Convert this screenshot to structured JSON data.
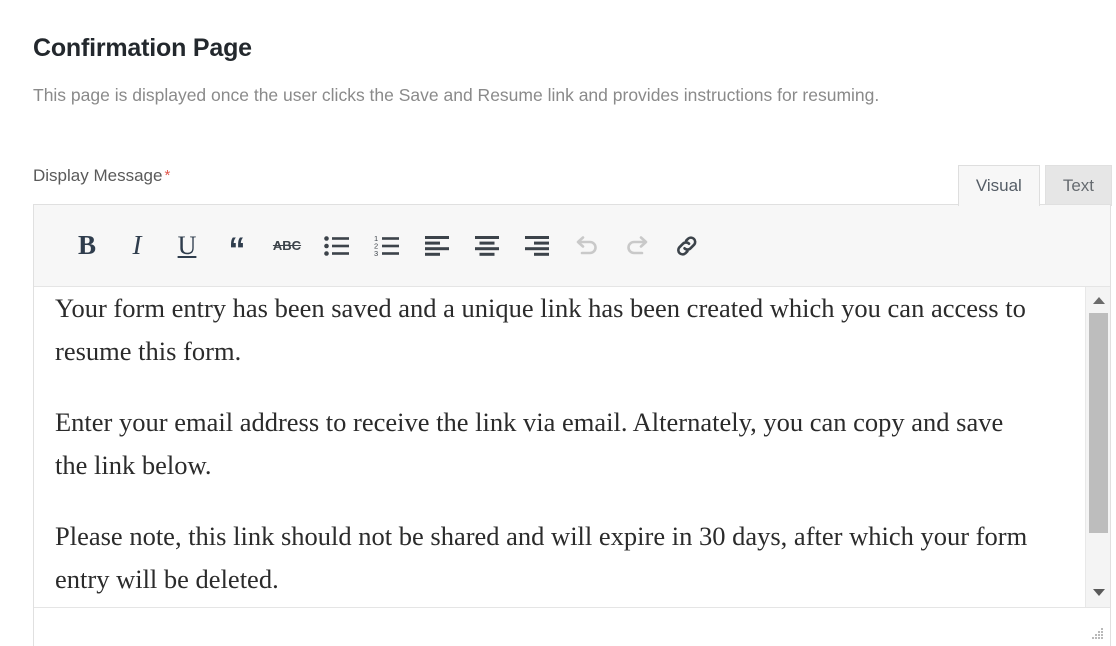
{
  "header": {
    "title": "Confirmation Page",
    "description": "This page is displayed once the user clicks the Save and Resume link and provides instructions for resuming."
  },
  "field": {
    "label": "Display Message",
    "required_marker": "*"
  },
  "editor": {
    "tabs": [
      {
        "label": "Visual",
        "active": true
      },
      {
        "label": "Text",
        "active": false
      }
    ],
    "toolbar": [
      {
        "name": "bold",
        "glyph": "B",
        "label": "Bold",
        "disabled": false
      },
      {
        "name": "italic",
        "glyph": "I",
        "label": "Italic",
        "disabled": false
      },
      {
        "name": "underline",
        "glyph": "U",
        "label": "Underline",
        "disabled": false
      },
      {
        "name": "blockquote",
        "glyph": "“",
        "label": "Blockquote",
        "disabled": false
      },
      {
        "name": "strikethrough",
        "glyph": "ABC",
        "label": "Strikethrough",
        "disabled": false
      },
      {
        "name": "bulleted-list",
        "glyph": "",
        "label": "Bulleted list",
        "disabled": false
      },
      {
        "name": "numbered-list",
        "glyph": "",
        "label": "Numbered list",
        "disabled": false
      },
      {
        "name": "align-left",
        "glyph": "",
        "label": "Align left",
        "disabled": false
      },
      {
        "name": "align-center",
        "glyph": "",
        "label": "Align center",
        "disabled": false
      },
      {
        "name": "align-right",
        "glyph": "",
        "label": "Align right",
        "disabled": false
      },
      {
        "name": "undo",
        "glyph": "",
        "label": "Undo",
        "disabled": true
      },
      {
        "name": "redo",
        "glyph": "",
        "label": "Redo",
        "disabled": true
      },
      {
        "name": "insert-link",
        "glyph": "",
        "label": "Insert/edit link",
        "disabled": false
      }
    ],
    "content": {
      "paragraphs": [
        "Your form entry has been saved and a unique link has been created which you can access to resume this form.",
        "Enter your email address to receive the link via email. Alternately, you can copy and save the link below.",
        "Please note, this link should not be shared and will expire in 30 days, after  which your form entry will be deleted."
      ]
    },
    "scrollbar": {
      "up_arrow": "▲",
      "down_arrow": "▼"
    }
  },
  "colors": {
    "required": "#e2574c",
    "title": "#23282d",
    "description": "#8a8a8a",
    "toolbar_bg": "#f7f7f7",
    "border": "#e0e0e0"
  }
}
